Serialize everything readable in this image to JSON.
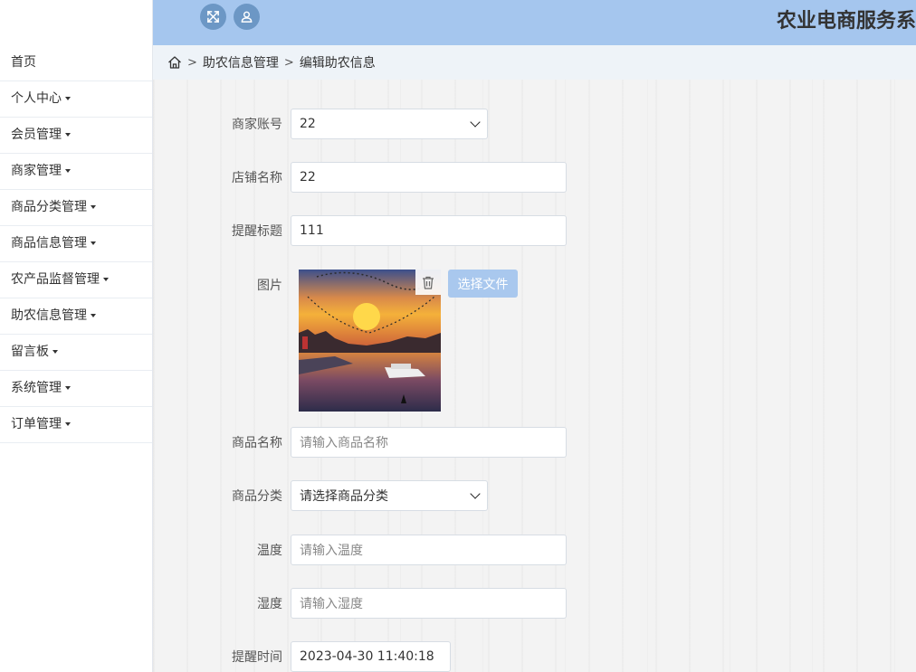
{
  "header": {
    "title": "农业电商服务系"
  },
  "sidebar": {
    "items": [
      {
        "label": "首页",
        "has_caret": false
      },
      {
        "label": "个人中心",
        "has_caret": true
      },
      {
        "label": "会员管理",
        "has_caret": true
      },
      {
        "label": "商家管理",
        "has_caret": true
      },
      {
        "label": "商品分类管理",
        "has_caret": true
      },
      {
        "label": "商品信息管理",
        "has_caret": true
      },
      {
        "label": "农产品监督管理",
        "has_caret": true
      },
      {
        "label": "助农信息管理",
        "has_caret": true
      },
      {
        "label": "留言板",
        "has_caret": true
      },
      {
        "label": "系统管理",
        "has_caret": true
      },
      {
        "label": "订单管理",
        "has_caret": true
      }
    ]
  },
  "breadcrumb": {
    "sep": ">",
    "level1": "助农信息管理",
    "level2": "编辑助农信息"
  },
  "form": {
    "merchant_account": {
      "label": "商家账号",
      "value": "22"
    },
    "shop_name": {
      "label": "店铺名称",
      "value": "22"
    },
    "reminder_title": {
      "label": "提醒标题",
      "value": "111"
    },
    "image": {
      "label": "图片",
      "choose_file_label": "选择文件"
    },
    "product_name": {
      "label": "商品名称",
      "placeholder": "请输入商品名称"
    },
    "product_category": {
      "label": "商品分类",
      "placeholder": "请选择商品分类"
    },
    "temperature": {
      "label": "温度",
      "placeholder": "请输入温度"
    },
    "humidity": {
      "label": "湿度",
      "placeholder": "请输入湿度"
    },
    "reminder_time": {
      "label": "提醒时间",
      "value": "2023-04-30 11:40:18"
    }
  },
  "colors": {
    "header_bg": "#a5c6ee",
    "icon_btn": "#6c97c5",
    "file_btn": "#a9c8ee"
  }
}
